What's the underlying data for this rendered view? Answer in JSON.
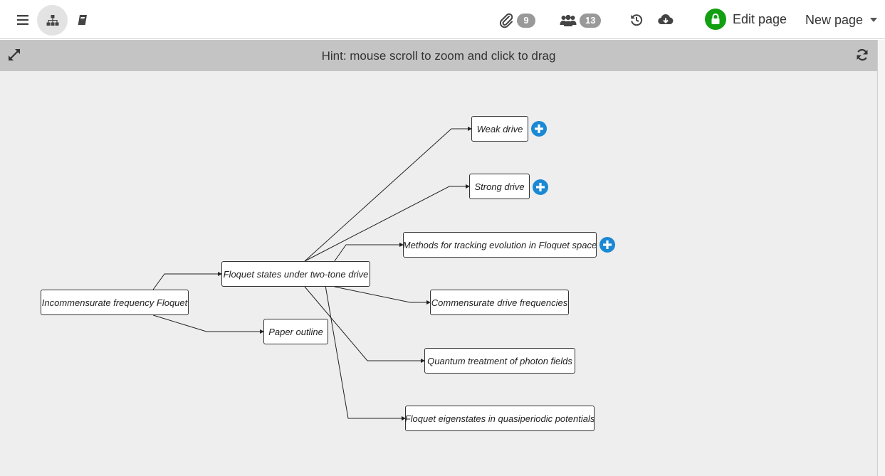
{
  "toolbar": {
    "attachments_count": "9",
    "collaborators_count": "13",
    "edit_label": "Edit page",
    "new_page_label": "New page"
  },
  "icons": {
    "menu": "hamburger-icon",
    "tree": "sitemap-icon",
    "book": "book-icon",
    "attach": "paperclip-icon",
    "users": "users-icon",
    "history": "history-icon",
    "download": "cloud-download-icon",
    "lock": "lock-icon",
    "expand": "expand-icon",
    "refresh": "refresh-icon",
    "plus": "plus-circle-icon"
  },
  "colors": {
    "accent_green": "#12a012",
    "plus_blue": "#1b88d4",
    "badge_gray": "#999999",
    "hint_bar": "#c4c4c4",
    "canvas_bg": "#eeeeee"
  },
  "hint": {
    "text": "Hint: mouse scroll to zoom and click to drag"
  },
  "graph": {
    "nodes": [
      {
        "id": "root",
        "label": "Incommensurate frequency Floquet"
      },
      {
        "id": "two_tone",
        "label": "Floquet states under two-tone drive"
      },
      {
        "id": "paper",
        "label": "Paper outline"
      },
      {
        "id": "weak",
        "label": "Weak drive"
      },
      {
        "id": "strong",
        "label": "Strong drive"
      },
      {
        "id": "methods",
        "label": "Methods for tracking evolution in Floquet space"
      },
      {
        "id": "commensurate",
        "label": "Commensurate drive frequencies"
      },
      {
        "id": "quantum",
        "label": "Quantum treatment of photon fields"
      },
      {
        "id": "eigenstates",
        "label": "Floquet eigenstates in quasiperiodic potentials"
      }
    ]
  }
}
